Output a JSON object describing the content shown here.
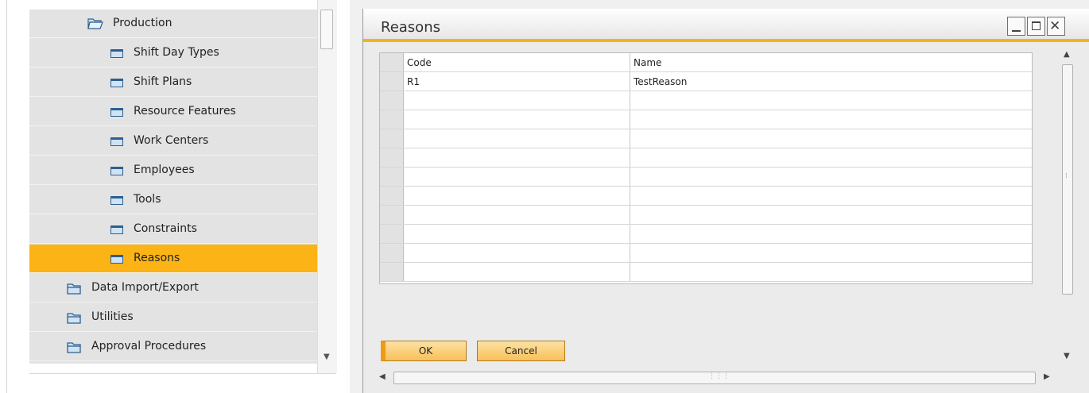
{
  "tree": {
    "parent": {
      "label": "Production",
      "icon": "folder-open-icon"
    },
    "children": [
      {
        "label": "Shift Day Types",
        "icon": "form-icon"
      },
      {
        "label": "Shift Plans",
        "icon": "form-icon"
      },
      {
        "label": "Resource Features",
        "icon": "form-icon"
      },
      {
        "label": "Work Centers",
        "icon": "form-icon"
      },
      {
        "label": "Employees",
        "icon": "form-icon"
      },
      {
        "label": "Tools",
        "icon": "form-icon"
      },
      {
        "label": "Constraints",
        "icon": "form-icon"
      },
      {
        "label": "Reasons",
        "icon": "form-icon",
        "selected": true
      }
    ],
    "siblings": [
      {
        "label": "Data Import/Export",
        "icon": "folder-icon"
      },
      {
        "label": "Utilities",
        "icon": "folder-icon"
      },
      {
        "label": "Approval Procedures",
        "icon": "folder-icon"
      }
    ],
    "selected_color": "#fbb316"
  },
  "window": {
    "title": "Reasons",
    "accent_color": "#f6b319",
    "controls": {
      "minimize": "minimize-icon",
      "maximize": "maximize-icon",
      "close": "close-icon"
    }
  },
  "grid": {
    "columns": [
      "Code",
      "Name"
    ],
    "rows": [
      [
        "R1",
        "TestReason"
      ],
      [
        "",
        ""
      ],
      [
        "",
        ""
      ],
      [
        "",
        ""
      ],
      [
        "",
        ""
      ],
      [
        "",
        ""
      ],
      [
        "",
        ""
      ],
      [
        "",
        ""
      ],
      [
        "",
        ""
      ],
      [
        "",
        ""
      ],
      [
        "",
        ""
      ]
    ]
  },
  "buttons": {
    "ok_label": "OK",
    "cancel_label": "Cancel"
  }
}
